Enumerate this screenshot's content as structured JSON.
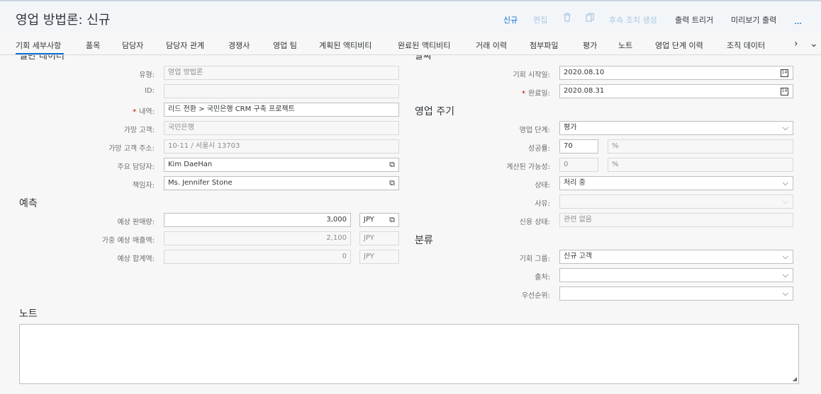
{
  "header": {
    "title": "영업 방법론: 신규",
    "actions": {
      "new": "신규",
      "edit": "편집",
      "followup": "후속 조치 생성",
      "output_trigger": "출력 트리거",
      "preview_output": "미리보기 출력",
      "more": "..."
    }
  },
  "tabs": [
    "기회 세부사항",
    "품목",
    "담당자",
    "담당자 관계",
    "경쟁사",
    "영업 팀",
    "계획된 액티비티",
    "완료된 액티비티",
    "거래 이력",
    "첨부파일",
    "평가",
    "노트",
    "영업 단계 이력",
    "조직 데이터"
  ],
  "sections": {
    "general_cut": "일반 데이터",
    "dates_cut": "날짜",
    "sales_cycle": "영업 주기",
    "forecast": "예측",
    "classification": "분류",
    "note": "노트"
  },
  "general": {
    "type_label": "유형:",
    "type_value": "영업 방법론",
    "id_label": "ID:",
    "id_value": "",
    "desc_label": "내역:",
    "desc_value": "리드 전환 > 국민은행 CRM 구축 프로젝트",
    "prospect_label": "가망 고객:",
    "prospect_value": "국민은행",
    "prospect_addr_label": "가망 고객 주소:",
    "prospect_addr_value": "10-11 / 서울시 13703",
    "main_contact_label": "주요 담당자:",
    "main_contact_value": "Kim DaeHan",
    "owner_label": "책임자:",
    "owner_value": "Ms. Jennifer Stone"
  },
  "forecast": {
    "exp_sales_label": "예상 판매량:",
    "exp_sales_value": "3,000",
    "exp_sales_curr": "JPY",
    "weighted_label": "가중 예상 매출액:",
    "weighted_value": "2,100",
    "weighted_curr": "JPY",
    "total_label": "예상 합계액:",
    "total_value": "0",
    "total_curr": "JPY"
  },
  "dates": {
    "start_label": "기회 시작일:",
    "start_value": "2020.08.10",
    "end_label": "완료일:",
    "end_value": "2020.08.31",
    "cal_glyph": "14"
  },
  "cycle": {
    "stage_label": "영업 단계:",
    "stage_value": "평가",
    "success_label": "성공률:",
    "success_value": "70",
    "success_unit": "%",
    "calc_label": "계산된 가능성:",
    "calc_value": "0",
    "calc_unit": "%",
    "status_label": "상태:",
    "status_value": "처리 중",
    "reason_label": "사유:",
    "reason_value": "",
    "credit_label": "신용 상태:",
    "credit_value": "관련 없음"
  },
  "classification": {
    "group_label": "기회 그룹:",
    "group_value": "신규 고객",
    "source_label": "출처:",
    "source_value": "",
    "priority_label": "우선순위:",
    "priority_value": ""
  },
  "icons": {
    "trash": "trash-icon",
    "copy": "copy-icon",
    "link": "open-link-icon",
    "chevron": "chevron-down-icon",
    "calendar": "calendar-icon"
  },
  "colors": {
    "accent": "#0a6ed1",
    "required": "#bb0000"
  }
}
